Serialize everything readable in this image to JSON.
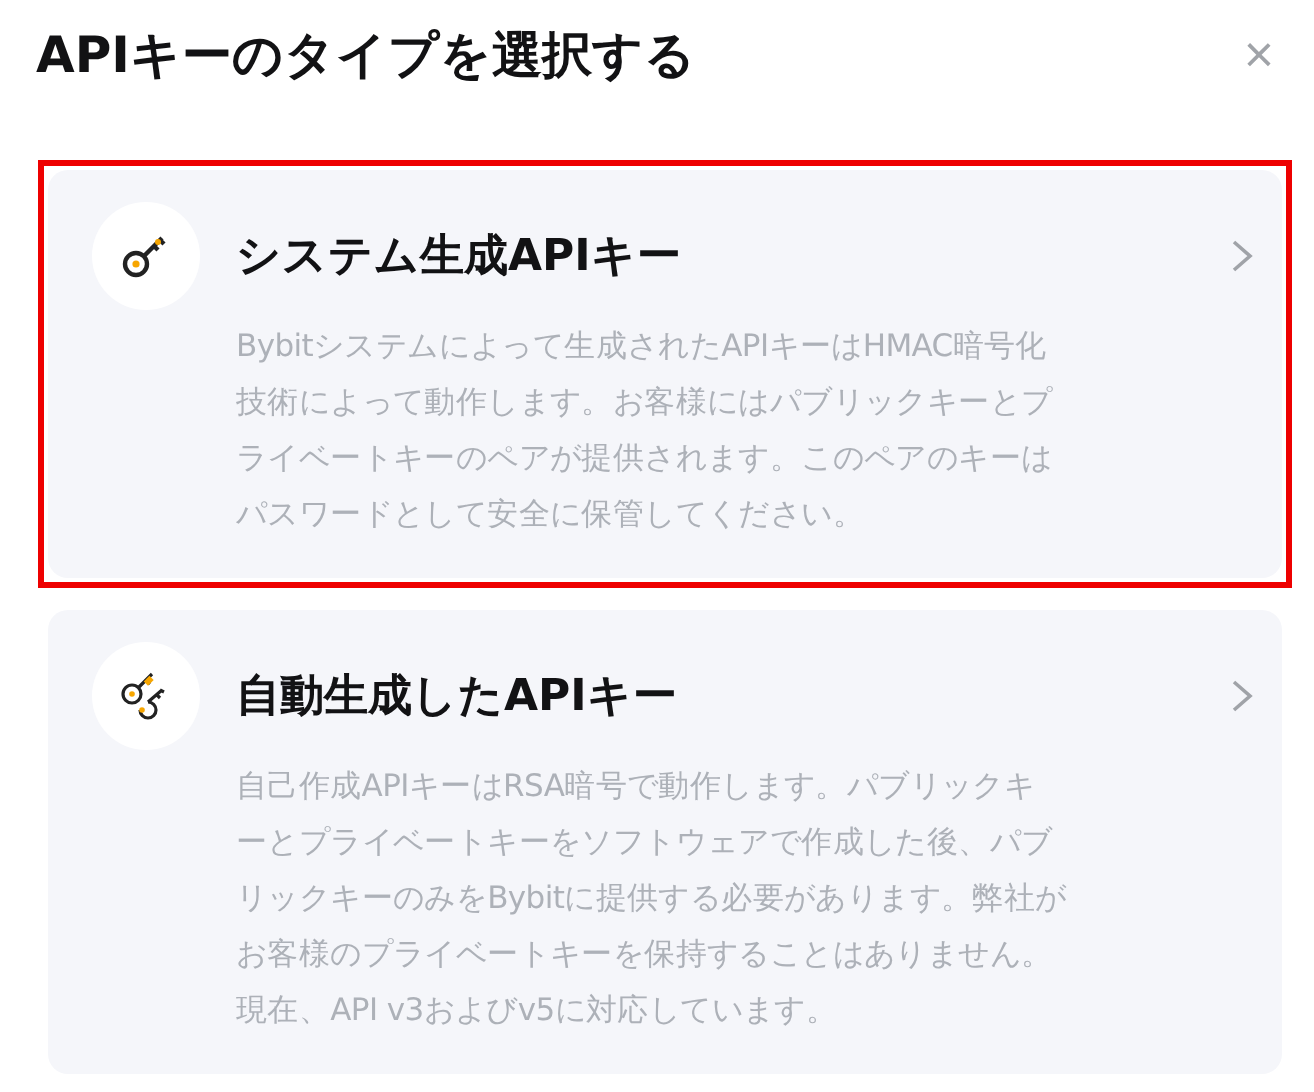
{
  "dialog": {
    "title": "APIキーのタイプを選択する",
    "close": "×"
  },
  "options": [
    {
      "kind": "system",
      "title": "システム生成APIキー",
      "highlighted": true,
      "description": [
        "Bybitシステムによって生成されたAPIキーはHMAC暗号化",
        "技術によって動作します。お客様にはパブリックキーとプ",
        "ライベートキーのペアが提供されます。このペアのキーは",
        "パスワードとして安全に保管してください。"
      ]
    },
    {
      "kind": "self",
      "title": "自動生成したAPIキー",
      "highlighted": false,
      "description": [
        "自己作成APIキーはRSA暗号で動作します。パブリックキ",
        "ーとプライベートキーをソフトウェアで作成した後、パブ",
        "リックキーのみをBybitに提供する必要があります。弊社が",
        "お客様のプライベートキーを保持することはありません。",
        "現在、API v3およびv5に対応しています。"
      ]
    }
  ]
}
